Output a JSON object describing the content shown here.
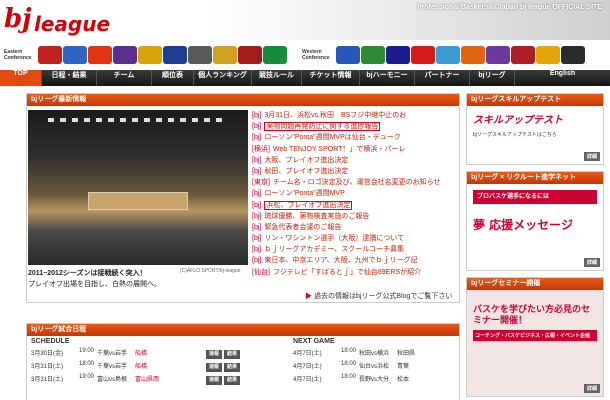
{
  "header": {
    "tagline": "Professional Basketball Japan  bj league OFFICIAL SITE",
    "logo_text": "bj",
    "logo_text2": "league"
  },
  "conferences": [
    {
      "label": "Eastern Conference"
    },
    {
      "label": "Western Conference"
    }
  ],
  "nav": [
    "TOP",
    "日程・結果",
    "チーム",
    "順位表",
    "個人ランキング",
    "競技ルール",
    "チケット情報",
    "bjハーモニー",
    "パートナー",
    "bjリーグ",
    "English"
  ],
  "latest": {
    "title": "bjリーグ最新情報",
    "items": [
      {
        "tag": "[bj]",
        "text": "3月31日、浜松vs.秋田　BSフジ中継中止のお",
        "boxed": false
      },
      {
        "tag": "[bj]",
        "text": "薬物問題再発防止に関する進捗報告",
        "boxed": true
      },
      {
        "tag": "[bj]",
        "text": "ローソン\"Ponta\"週間MVPは仙台・デューク",
        "boxed": false
      },
      {
        "tag": "[横浜]",
        "text": "Web TENJOY SPORT！」で横浜・パーレ",
        "boxed": false
      },
      {
        "tag": "[bj]",
        "text": "大阪、プレイオフ進出決定",
        "boxed": false
      },
      {
        "tag": "[bj]",
        "text": "秋田、プレイオフ進出決定",
        "boxed": false
      },
      {
        "tag": "[東京]",
        "text": "チーム名・ロゴ決定及び、運営会社名変更のお知らせ",
        "boxed": false
      },
      {
        "tag": "[bj]",
        "text": "ローソン\"Ponta\"週間MVP",
        "boxed": false
      },
      {
        "tag": "[bj]",
        "text": "浜松、プレイオフ進出決定",
        "boxed": true
      },
      {
        "tag": "[bj]",
        "text": "琉球優勝、薬物検査実施のご報告",
        "boxed": false
      },
      {
        "tag": "[bj]",
        "text": "緊急代表者会議のご報告",
        "boxed": false
      },
      {
        "tag": "[bj]",
        "text": "リン・ワシントン選手（大阪）逮捕について",
        "boxed": false
      },
      {
        "tag": "[bj]",
        "text": "ｂｊリーグアカデミー、スクールコーチ募集",
        "boxed": false
      },
      {
        "tag": "[bj]",
        "text": "東日本、中京エリア、大阪、九州でｂｊリーグ記",
        "boxed": false
      },
      {
        "tag": "[仙台]",
        "text": "フジテレビ「すばるとｊ」で仙台89ERSが紹介",
        "boxed": false
      }
    ],
    "caption1": "2011−2012シーズンは接戦続く突入！",
    "caption2": "プレイオフ出場を目指し、白熱の展開へ。",
    "credit": "(C)AFLO SPORT/bj-league",
    "more": "過去の情報はbjリーグ公式Blogでご覧下さい"
  },
  "schedule": {
    "title": "bjリーグ試合日程",
    "left_h": "SCHEDULE",
    "right_h": "NEXT GAME",
    "left": [
      {
        "date": "3月30日(金)",
        "time": "19:00",
        "match": "千葉vs岩手",
        "venue": "船橋",
        "b1": "速報",
        "b2": "結果"
      },
      {
        "date": "3月31日(土)",
        "time": "18:00",
        "match": "千葉vs岩手",
        "venue": "船橋",
        "b1": "速報",
        "b2": "結果"
      },
      {
        "date": "3月31日(土)",
        "time": "19:00",
        "match": "富山vs島根",
        "venue": "富山県西",
        "b1": "速報",
        "b2": "結果"
      }
    ],
    "right": [
      {
        "date": "4月7日(土)",
        "time": "18:00",
        "match": "秋田vs横浜",
        "venue": "秋田県"
      },
      {
        "date": "4月7日(土)",
        "time": "18:00",
        "match": "仙台vs浜松",
        "venue": "青葉"
      },
      {
        "date": "4月7日(土)",
        "time": "18:00",
        "match": "長野vs大分",
        "venue": "松本"
      }
    ]
  },
  "side": [
    {
      "title": "bjリーグスキルアップテスト",
      "text": "スキルアップテスト",
      "sub": "bjリーグスキルアップテストはこちら",
      "detail": "詳細"
    },
    {
      "title": "bjリーグ × リクルート進学ネット",
      "text": "プロバスケ選手になるには",
      "sub": "夢 応援メッセージ",
      "detail": "詳細"
    },
    {
      "title": "bjリーグセミナー開催",
      "text": "バスケを学びたい方必見のセミナー開催！",
      "sub": "コーチング・バスケビジネス・広報・イベント企画",
      "detail": "詳細"
    }
  ],
  "colors": {
    "accent": "#e34a10",
    "link": "#c0240a"
  }
}
